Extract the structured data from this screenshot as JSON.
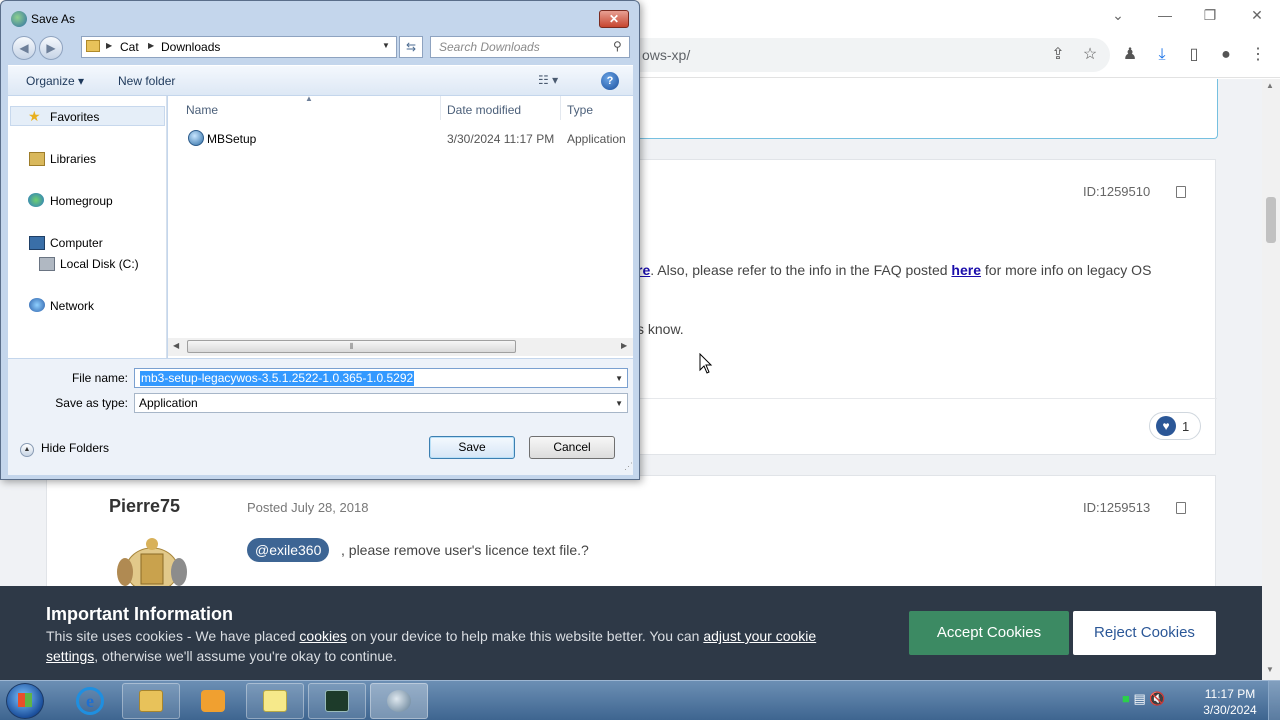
{
  "browser": {
    "url_fragment": "ows-xp/",
    "window_controls": {
      "minimize": "—",
      "restore": "❐",
      "close": "✕",
      "tabs_menu": "⌄"
    }
  },
  "post1": {
    "id": "ID:1259510",
    "text1_prefix": "re",
    "text1_mid": ".  Also, please refer to the info in the FAQ posted ",
    "text1_link": "here",
    "text1_suffix": " for more info on legacy OS",
    "text2": "s know.",
    "reaction_count": "1"
  },
  "post2": {
    "author": "Pierre75",
    "date": "Posted July 28, 2018",
    "id": "ID:1259513",
    "mention": "@exile360",
    "text": ", please remove user's licence text file.?"
  },
  "cookie": {
    "title": "Important Information",
    "text_a": "This site uses cookies - We have placed ",
    "link_cookies": "cookies",
    "text_b": " on your device to help make this website better. You can ",
    "link_adjust": "adjust your cookie settings",
    "text_c": ", otherwise we'll assume you're okay to continue.",
    "accept_label": " Accept Cookies",
    "reject_label": "Reject Cookies"
  },
  "dialog": {
    "title": "Save As",
    "close_glyph": "✕",
    "breadcrumb": [
      "Cat",
      "Downloads"
    ],
    "search_placeholder": "Search Downloads",
    "organize_label": "Organize ▾",
    "new_folder_label": "New folder",
    "nav": {
      "favorites": "Favorites",
      "libraries": "Libraries",
      "homegroup": "Homegroup",
      "computer": "Computer",
      "local_disk": "Local Disk (C:)",
      "network": "Network"
    },
    "columns": {
      "name": "Name",
      "date": "Date modified",
      "type": "Type"
    },
    "files": [
      {
        "name": "MBSetup",
        "date": "3/30/2024 11:17 PM",
        "type": "Application"
      }
    ],
    "file_name_label": "File name:",
    "file_name_value": "mb3-setup-legacywos-3.5.1.2522-1.0.365-1.0.5292",
    "save_type_label": "Save as type:",
    "save_type_value": "Application",
    "hide_folders_label": "Hide Folders",
    "save_label": "Save",
    "cancel_label": "Cancel"
  },
  "taskbar": {
    "time": "11:17 PM",
    "date": "3/30/2024"
  },
  "colors": {
    "cookie_bg": "#2e3947",
    "accept": "#3c8a63",
    "mention": "#3d6594",
    "selection": "#3399ff"
  }
}
